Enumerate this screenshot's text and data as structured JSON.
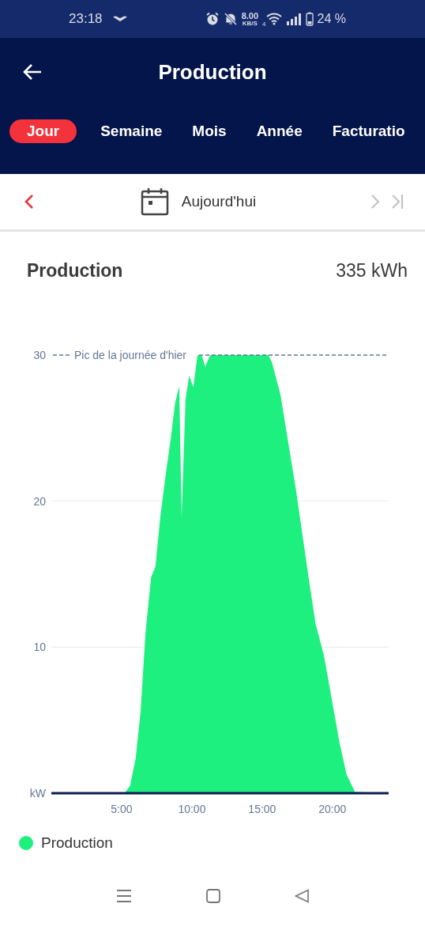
{
  "status_bar": {
    "time": "23:18",
    "speed": "8.00",
    "speed_unit": "KB/S",
    "network": "4",
    "battery": "24 %"
  },
  "header": {
    "title": "Production"
  },
  "tabs": [
    {
      "label": "Jour",
      "selected": true
    },
    {
      "label": "Semaine",
      "selected": false
    },
    {
      "label": "Mois",
      "selected": false
    },
    {
      "label": "Année",
      "selected": false
    },
    {
      "label": "Facturatio",
      "selected": false
    }
  ],
  "date_bar": {
    "label": "Aujourd'hui",
    "prev_disabled": false,
    "next_disabled": true
  },
  "card": {
    "title": "Production",
    "total": "335 kWh",
    "chart_data": {
      "type": "area",
      "xlim": [
        0,
        24
      ],
      "ylim": [
        0,
        30
      ],
      "x": [
        0,
        5.2,
        5.6,
        6.0,
        6.35,
        6.7,
        7.1,
        7.4,
        7.75,
        8.15,
        8.5,
        8.8,
        9.1,
        9.27,
        9.55,
        9.8,
        10.1,
        10.4,
        10.7,
        10.95,
        11.3,
        15.45,
        15.7,
        16.3,
        17.4,
        18.3,
        18.8,
        19.4,
        20.5,
        21.0,
        21.6,
        24
      ],
      "series": [
        {
          "name": "Production",
          "color": "#1ef07f",
          "values": [
            0,
            0,
            0.5,
            2.4,
            5.6,
            11,
            14.8,
            15.5,
            18.9,
            21.9,
            24.3,
            26.7,
            27.9,
            18.9,
            27.0,
            28.6,
            27.8,
            30,
            30,
            29.2,
            30,
            30,
            29.5,
            27.3,
            20.8,
            14.8,
            11.6,
            9.4,
            3.5,
            1.3,
            0.1,
            0
          ]
        }
      ],
      "xticks": [
        {
          "value": 5,
          "label": "5:00"
        },
        {
          "value": 10,
          "label": "10:00"
        },
        {
          "value": 15,
          "label": "15:00"
        },
        {
          "value": 20,
          "label": "20:00"
        }
      ],
      "yticks": [
        {
          "value": 0,
          "label": "kW"
        },
        10,
        20,
        30
      ]
    },
    "reference_line": {
      "label": "Pic de la journée d'hier"
    }
  }
}
